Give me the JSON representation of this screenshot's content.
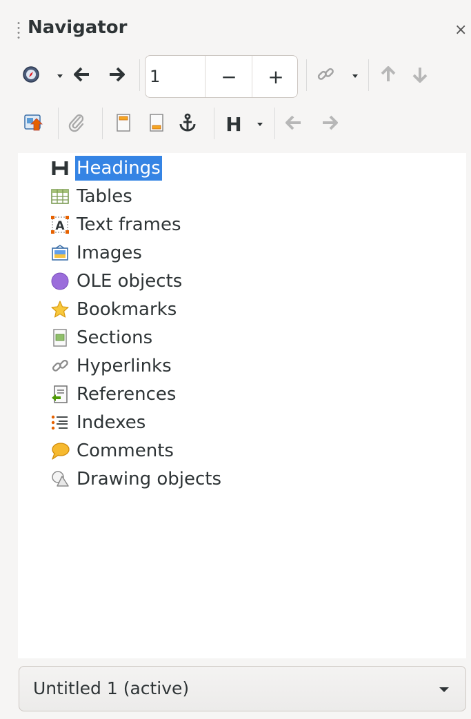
{
  "header": {
    "title": "Navigator",
    "close_glyph": "×"
  },
  "toolbar1": {
    "navigate_by_icon": "compass-icon",
    "back_icon": "arrow-left-icon",
    "forward_icon": "arrow-right-icon",
    "page_value": "1",
    "minus_label": "−",
    "plus_label": "+",
    "drag_mode_icon": "link-icon",
    "move_up_icon": "arrow-up-icon",
    "move_down_icon": "arrow-down-icon"
  },
  "toolbar2": {
    "icons": [
      "content-navigation-icon",
      "paperclip-icon",
      "header-icon",
      "footer-icon",
      "anchor-icon",
      "heading-levels-icon",
      "promote-icon",
      "demote-icon"
    ],
    "heading_levels_label": "H"
  },
  "tree": {
    "items": [
      {
        "label": "Headings",
        "icon": "heading-icon",
        "selected": true
      },
      {
        "label": "Tables",
        "icon": "table-icon"
      },
      {
        "label": "Text frames",
        "icon": "text-frame-icon"
      },
      {
        "label": "Images",
        "icon": "image-icon"
      },
      {
        "label": "OLE objects",
        "icon": "ole-object-icon"
      },
      {
        "label": "Bookmarks",
        "icon": "star-icon"
      },
      {
        "label": "Sections",
        "icon": "section-icon"
      },
      {
        "label": "Hyperlinks",
        "icon": "hyperlink-icon"
      },
      {
        "label": "References",
        "icon": "reference-icon"
      },
      {
        "label": "Indexes",
        "icon": "index-icon"
      },
      {
        "label": "Comments",
        "icon": "comment-icon"
      },
      {
        "label": "Drawing objects",
        "icon": "drawing-object-icon"
      }
    ]
  },
  "document_select": {
    "value": "Untitled 1 (active)"
  },
  "colors": {
    "selection": "#3584e4",
    "panel_bg": "#f6f5f4",
    "list_bg": "#ffffff"
  }
}
